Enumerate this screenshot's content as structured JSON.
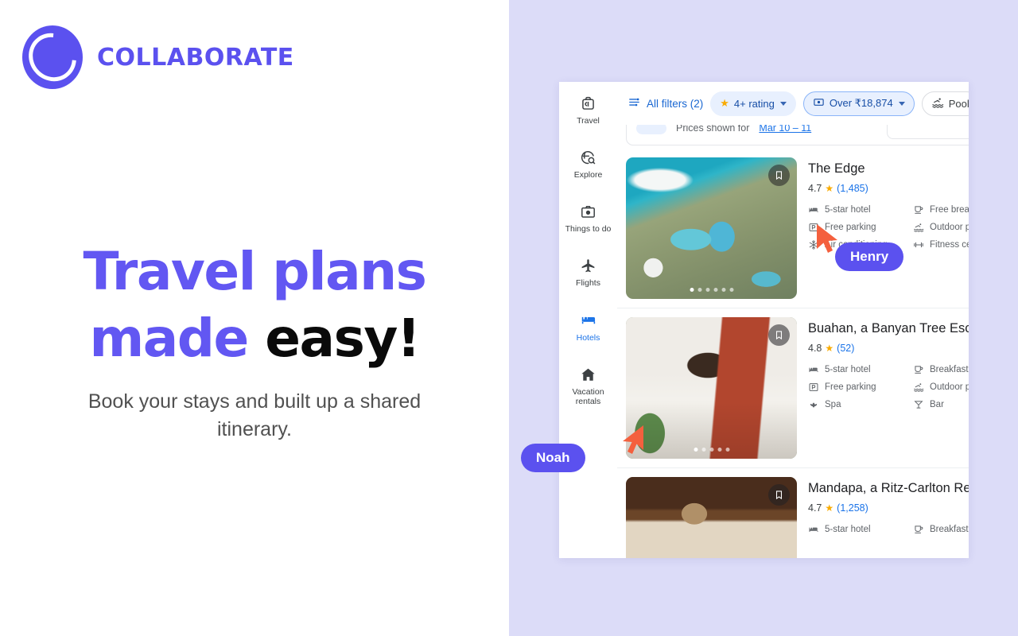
{
  "brand": {
    "name": "COLLABORATE",
    "accent_color": "#5b51ef",
    "logo_icon": "collaborate-circle-logo"
  },
  "hero": {
    "headline_line1": "Travel plans",
    "headline_line2_purple": "made ",
    "headline_line2_black": "easy!",
    "subheadline": "Book your stays and built up a shared itinerary.",
    "headline_color": "#6257f2",
    "headline_accent_color": "#0a0a0a"
  },
  "app": {
    "rail": {
      "items": [
        {
          "label": "Travel",
          "icon": "suitcase-icon",
          "active": false
        },
        {
          "label": "Explore",
          "icon": "explore-globe-icon",
          "active": false
        },
        {
          "label": "Things to do",
          "icon": "camera-icon",
          "active": false
        },
        {
          "label": "Flights",
          "icon": "airplane-icon",
          "active": false
        },
        {
          "label": "Hotels",
          "icon": "bed-icon",
          "active": true
        },
        {
          "label": "Vacation rentals",
          "icon": "house-icon",
          "active": false
        }
      ]
    },
    "filters": {
      "all_filters_label": "All filters (2)",
      "all_filters_icon": "tune-sliders-icon",
      "chips": [
        {
          "label": "4+ rating",
          "icon": "star-icon",
          "style": "filled",
          "caret": true
        },
        {
          "label": "Over ₹18,874",
          "icon": "price-icon",
          "style": "outlined-active",
          "caret": true
        },
        {
          "label": "Pool",
          "icon": "pool-icon",
          "style": "plain",
          "caret": false
        }
      ]
    },
    "prices_row": {
      "text": "Prices shown for",
      "link": "Mar 10 – 11"
    },
    "results": [
      {
        "name": "The Edge",
        "rating": "4.7",
        "star_icon": "star-icon",
        "reviews": "(1,485)",
        "photo": "aerial-cliffside-resort-pools",
        "bookmark_icon": "bookmark-icon",
        "dots_total": 6,
        "dots_active": 1,
        "amenities": [
          {
            "label": "5-star hotel",
            "icon": "bed-icon"
          },
          {
            "label": "Free breakfast",
            "icon": "coffee-cup-icon"
          },
          {
            "label": "Free parking",
            "icon": "parking-icon"
          },
          {
            "label": "Outdoor pool",
            "icon": "pool-icon"
          },
          {
            "label": "Air conditioning",
            "icon": "snowflake-icon"
          },
          {
            "label": "Fitness center",
            "icon": "dumbbell-icon"
          }
        ]
      },
      {
        "name": "Buahan, a Banyan Tree Esca",
        "rating": "4.8",
        "star_icon": "star-icon",
        "reviews": "(52)",
        "photo": "canopy-bed-villa-interior",
        "bookmark_icon": "bookmark-icon",
        "dots_total": 5,
        "dots_active": 1,
        "amenities": [
          {
            "label": "5-star hotel",
            "icon": "bed-icon"
          },
          {
            "label": "Breakfast",
            "icon": "coffee-cup-icon"
          },
          {
            "label": "Free parking",
            "icon": "parking-icon"
          },
          {
            "label": "Outdoor pool",
            "icon": "pool-icon"
          },
          {
            "label": "Spa",
            "icon": "spa-lotus-icon"
          },
          {
            "label": "Bar",
            "icon": "cocktail-glass-icon"
          }
        ]
      },
      {
        "name": "Mandapa, a Ritz-Carlton Re",
        "rating": "4.7",
        "star_icon": "star-icon",
        "reviews": "(1,258)",
        "photo": "wood-lobby-drum-lamp",
        "bookmark_icon": "bookmark-icon",
        "dots_total": 0,
        "dots_active": 0,
        "amenities": [
          {
            "label": "5-star hotel",
            "icon": "bed-icon"
          },
          {
            "label": "Breakfast ($)",
            "icon": "coffee-cup-icon"
          }
        ]
      }
    ]
  },
  "cursors": [
    {
      "name": "Henry",
      "color": "#5b51ef",
      "pointer_color": "#f4603e"
    },
    {
      "name": "Noah",
      "color": "#5b51ef",
      "pointer_color": "#f4603e"
    }
  ],
  "stage": {
    "background_color": "#dcdcf8"
  }
}
